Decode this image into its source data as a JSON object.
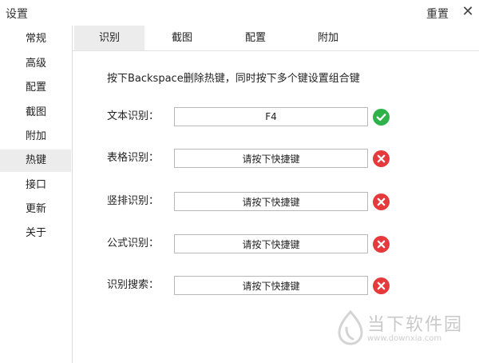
{
  "window": {
    "title": "设置",
    "reset_label": "重置",
    "close_glyph": "✕"
  },
  "sidebar": {
    "items": [
      {
        "label": "常规",
        "active": false
      },
      {
        "label": "高级",
        "active": false
      },
      {
        "label": "配置",
        "active": false
      },
      {
        "label": "截图",
        "active": false
      },
      {
        "label": "附加",
        "active": false
      },
      {
        "label": "热键",
        "active": true
      },
      {
        "label": "接口",
        "active": false
      },
      {
        "label": "更新",
        "active": false
      },
      {
        "label": "关于",
        "active": false
      }
    ]
  },
  "tabs": [
    {
      "label": "识别",
      "active": true
    },
    {
      "label": "截图",
      "active": false
    },
    {
      "label": "配置",
      "active": false
    },
    {
      "label": "附加",
      "active": false
    }
  ],
  "hint": "按下Backspace删除热键，同时按下多个键设置组合键",
  "hotkeys": [
    {
      "label": "文本识别：",
      "value": "F4",
      "status": "set"
    },
    {
      "label": "表格识别：",
      "value": "请按下快捷键",
      "status": "unset"
    },
    {
      "label": "竖排识别：",
      "value": "请按下快捷键",
      "status": "unset"
    },
    {
      "label": "公式识别：",
      "value": "请按下快捷键",
      "status": "unset"
    },
    {
      "label": "识别搜索：",
      "value": "请按下快捷键",
      "status": "unset"
    }
  ],
  "colors": {
    "ok": "#2fb24a",
    "error": "#e5393b",
    "active_bg": "#ececec"
  },
  "icons": {
    "set": "check-circle-icon",
    "unset": "error-circle-icon"
  },
  "watermark": {
    "title": "当下软件园",
    "url": "www.downxia.com"
  }
}
